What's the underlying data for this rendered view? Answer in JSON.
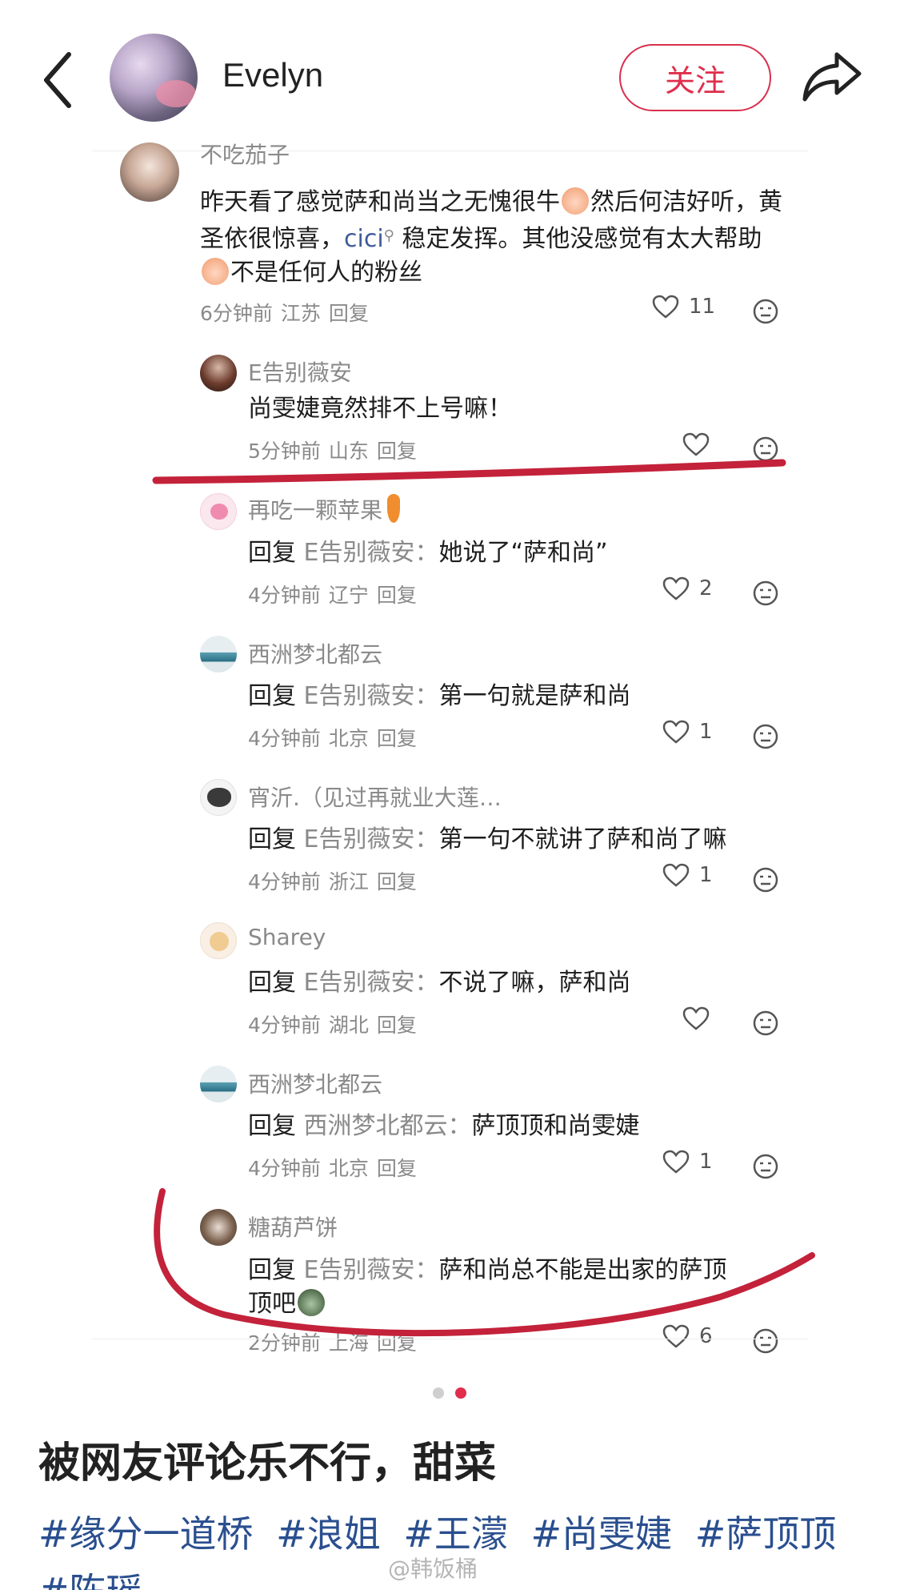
{
  "header": {
    "user_name": "Evelyn",
    "follow_label": "关注"
  },
  "comments": {
    "main": {
      "user": "不吃茄子",
      "text_1": "昨天看了感觉萨和尚当之无愧很牛",
      "text_2": "然后何洁好听，黄圣依很惊喜，",
      "text_link": "cici",
      "text_3": " 稳定发挥。其他没感觉有太大帮助",
      "text_4": "不是任何人的粉丝",
      "time": "6分钟前",
      "location": "江苏",
      "reply_label": "回复",
      "likes": "11"
    },
    "replies": [
      {
        "user": "E告别薇安",
        "prefix": "",
        "target": "",
        "text": "尚雯婕竟然排不上号嘛！",
        "time": "5分钟前",
        "location": "山东",
        "reply_label": "回复",
        "likes": ""
      },
      {
        "user": "再吃一颗苹果",
        "prefix": "回复",
        "target": "E告别薇安：",
        "text": "她说了“萨和尚”",
        "time": "4分钟前",
        "location": "辽宁",
        "reply_label": "回复",
        "likes": "2"
      },
      {
        "user": "西洲梦北都云",
        "prefix": "回复",
        "target": "E告别薇安：",
        "text": "第一句就是萨和尚",
        "time": "4分钟前",
        "location": "北京",
        "reply_label": "回复",
        "likes": "1"
      },
      {
        "user": "宵沂.（见过再就业大莲…",
        "prefix": "回复",
        "target": "E告别薇安：",
        "text": "第一句不就讲了萨和尚了嘛",
        "time": "4分钟前",
        "location": "浙江",
        "reply_label": "回复",
        "likes": "1"
      },
      {
        "user": "Sharey",
        "prefix": "回复",
        "target": "E告别薇安：",
        "text": "不说了嘛，萨和尚",
        "time": "4分钟前",
        "location": "湖北",
        "reply_label": "回复",
        "likes": ""
      },
      {
        "user": "西洲梦北都云",
        "prefix": "回复",
        "target": "西洲梦北都云：",
        "text": "萨顶顶和尚雯婕",
        "time": "4分钟前",
        "location": "北京",
        "reply_label": "回复",
        "likes": "1"
      },
      {
        "user": "糖葫芦饼",
        "prefix": "回复",
        "target": "E告别薇安：",
        "text": "萨和尚总不能是出家的萨顶",
        "text_2": "顶吧",
        "time": "2分钟前",
        "location": "上海",
        "reply_label": "回复",
        "likes": "6"
      }
    ]
  },
  "post": {
    "title": "被网友评论乐不行，甜菜",
    "tags": [
      "#缘分一道桥",
      "#浪姐",
      "#王濛",
      "#尚雯婕",
      "#萨顶顶",
      "#陈瑶"
    ]
  },
  "watermark": "@韩饭桶",
  "colors": {
    "accent": "#e02e4c",
    "tag": "#2a4f8f",
    "annotation": "#c3223a"
  },
  "icons": [
    "back-icon",
    "share-icon",
    "heart-icon",
    "emoji-icon"
  ]
}
